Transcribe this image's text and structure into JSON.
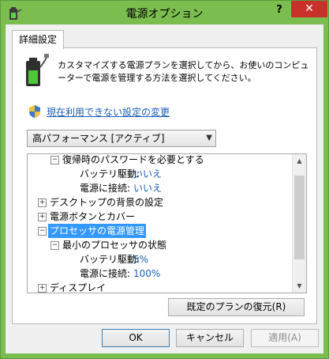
{
  "window": {
    "title": "電源オプション",
    "help_label": "?",
    "close_label": "✕"
  },
  "tab": {
    "label": "詳細設定"
  },
  "description": "カスタマイズする電源プランを選択してから、お使いのコンピューターで電源を管理する方法を選択してください。",
  "link": {
    "label": "現在利用できない設定の変更"
  },
  "plan_dropdown": {
    "value": "高パフォーマンス [アクティブ]"
  },
  "tree": {
    "items": [
      {
        "expander": "−",
        "label": "復帰時のパスワードを必要とする"
      },
      {
        "label": "バッテリ駆動:",
        "value": "いいえ"
      },
      {
        "label": "電源に接続:",
        "value": "いいえ"
      },
      {
        "expander": "+",
        "label": "デスクトップの背景の設定"
      },
      {
        "expander": "+",
        "label": "電源ボタンとカバー"
      },
      {
        "expander": "−",
        "label": "プロセッサの電源管理"
      },
      {
        "expander": "−",
        "label": "最小のプロセッサの状態"
      },
      {
        "label": "バッテリ駆動:",
        "value": "5%"
      },
      {
        "label": "電源に接続:",
        "value": "100%"
      },
      {
        "expander": "+",
        "label": "ディスプレイ"
      }
    ]
  },
  "buttons": {
    "restore": "既定のプランの復元(R)",
    "ok": "OK",
    "cancel": "キャンセル",
    "apply": "適用(A)"
  },
  "colors": {
    "titlebar": "#7cbd4f",
    "close": "#c7312a",
    "selection": "#3399ff",
    "link": "#1a5fb4"
  }
}
